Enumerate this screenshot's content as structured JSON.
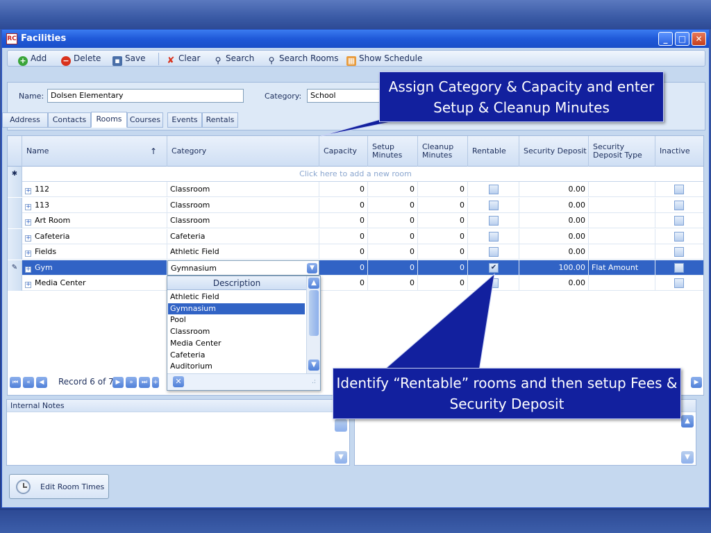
{
  "window": {
    "title": "Facilities",
    "logo": "RC"
  },
  "toolbar": {
    "add": "Add",
    "delete": "Delete",
    "save": "Save",
    "clear": "Clear",
    "search": "Search",
    "search_rooms": "Search Rooms",
    "show_schedule": "Show Schedule"
  },
  "form": {
    "name_label": "Name:",
    "name_value": "Dolsen Elementary",
    "category_label": "Category:",
    "category_value": "School"
  },
  "tabs": [
    "Address",
    "Contacts",
    "Rooms",
    "Courses",
    "Events",
    "Rentals"
  ],
  "active_tab": "Rooms",
  "grid": {
    "headers": {
      "name": "Name",
      "category": "Category",
      "capacity": "Capacity",
      "setup": "Setup Minutes",
      "cleanup": "Cleanup Minutes",
      "rentable": "Rentable",
      "deposit": "Security Deposit",
      "deposit_type": "Security Deposit Type",
      "inactive": "Inactive"
    },
    "add_row_text": "Click here to add a new room",
    "rows": [
      {
        "name": "112",
        "category": "Classroom",
        "capacity": "0",
        "setup": "0",
        "cleanup": "0",
        "rentable": false,
        "deposit": "0.00",
        "deposit_type": "",
        "inactive": false
      },
      {
        "name": "113",
        "category": "Classroom",
        "capacity": "0",
        "setup": "0",
        "cleanup": "0",
        "rentable": false,
        "deposit": "0.00",
        "deposit_type": "",
        "inactive": false
      },
      {
        "name": "Art Room",
        "category": "Classroom",
        "capacity": "0",
        "setup": "0",
        "cleanup": "0",
        "rentable": false,
        "deposit": "0.00",
        "deposit_type": "",
        "inactive": false
      },
      {
        "name": "Cafeteria",
        "category": "Cafeteria",
        "capacity": "0",
        "setup": "0",
        "cleanup": "0",
        "rentable": false,
        "deposit": "0.00",
        "deposit_type": "",
        "inactive": false
      },
      {
        "name": "Fields",
        "category": "Athletic Field",
        "capacity": "0",
        "setup": "0",
        "cleanup": "0",
        "rentable": false,
        "deposit": "0.00",
        "deposit_type": "",
        "inactive": false
      },
      {
        "name": "Gym",
        "category": "Gymnasium",
        "capacity": "0",
        "setup": "0",
        "cleanup": "0",
        "rentable": true,
        "deposit": "100.00",
        "deposit_type": "Flat Amount",
        "inactive": false
      },
      {
        "name": "Media Center",
        "category": "",
        "capacity": "0",
        "setup": "0",
        "cleanup": "0",
        "rentable": false,
        "deposit": "0.00",
        "deposit_type": "",
        "inactive": false
      }
    ]
  },
  "dropdown": {
    "header": "Description",
    "items": [
      "Athletic Field",
      "Gymnasium",
      "Pool",
      "Classroom",
      "Media Center",
      "Cafeteria",
      "Auditorium"
    ],
    "selected": "Gymnasium"
  },
  "navigator": {
    "record_text": "Record 6 of 7"
  },
  "notes": {
    "internal_label": "Internal Notes"
  },
  "buttons": {
    "edit_room_times": "Edit Room Times"
  },
  "callouts": {
    "top": "Assign Category & Capacity and enter Setup & Cleanup Minutes",
    "bottom": "Identify “Rentable” rooms and then setup Fees & Security Deposit"
  },
  "colors": {
    "accent": "#3163c5",
    "callout_bg": "#12209e",
    "titlebar": "#1f58d8"
  }
}
